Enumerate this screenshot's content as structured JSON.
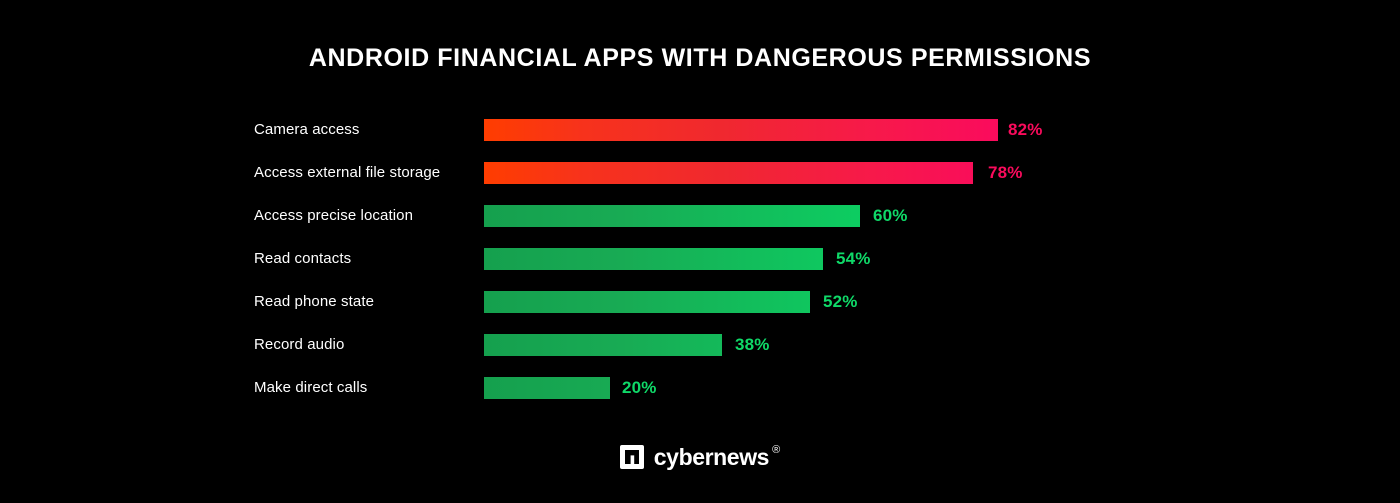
{
  "chart_data": {
    "type": "bar",
    "orientation": "horizontal",
    "title": "ANDROID FINANCIAL APPS WITH DANGEROUS PERMISSIONS",
    "subtitle": "",
    "xlabel": "",
    "ylabel": "",
    "xlim": [
      0,
      100
    ],
    "grid": false,
    "legend": false,
    "value_suffix": "%",
    "categories": [
      "Camera access",
      "Access external file storage",
      "Access precise location",
      "Read contacts",
      "Read phone state",
      "Record audio",
      "Make direct calls"
    ],
    "values": [
      82,
      78,
      60,
      54,
      52,
      38,
      20
    ],
    "value_labels": [
      "82%",
      "78%",
      "60%",
      "54%",
      "52%",
      "38%",
      "20%"
    ],
    "bars": [
      {
        "label": "Camera access",
        "value": 82,
        "value_label": "82%",
        "color_scheme": "red"
      },
      {
        "label": "Access external file storage",
        "value": 78,
        "value_label": "78%",
        "color_scheme": "red"
      },
      {
        "label": "Access precise location",
        "value": 60,
        "value_label": "60%",
        "color_scheme": "green"
      },
      {
        "label": "Read contacts",
        "value": 54,
        "value_label": "54%",
        "color_scheme": "green"
      },
      {
        "label": "Read phone state",
        "value": 52,
        "value_label": "52%",
        "color_scheme": "green"
      },
      {
        "label": "Record audio",
        "value": 38,
        "value_label": "38%",
        "color_scheme": "green"
      },
      {
        "label": "Make direct calls",
        "value": 20,
        "value_label": "20%",
        "color_scheme": "green"
      }
    ]
  },
  "colors": {
    "background": "#000000",
    "title_text": "#ffffff",
    "label_text": "#ffffff",
    "red_gradient_start": "#ff3d00",
    "red_gradient_end": "#fa0b5d",
    "green_gradient_start": "#15a04e",
    "green_gradient_end": "#00e96a",
    "red_value_text": "#fa0b5c",
    "green_value_text": "#0fd968"
  },
  "footer": {
    "logo_mark_name": "cybernews-square-mark-icon",
    "wordmark": "cybernews",
    "registered_mark": "®"
  }
}
